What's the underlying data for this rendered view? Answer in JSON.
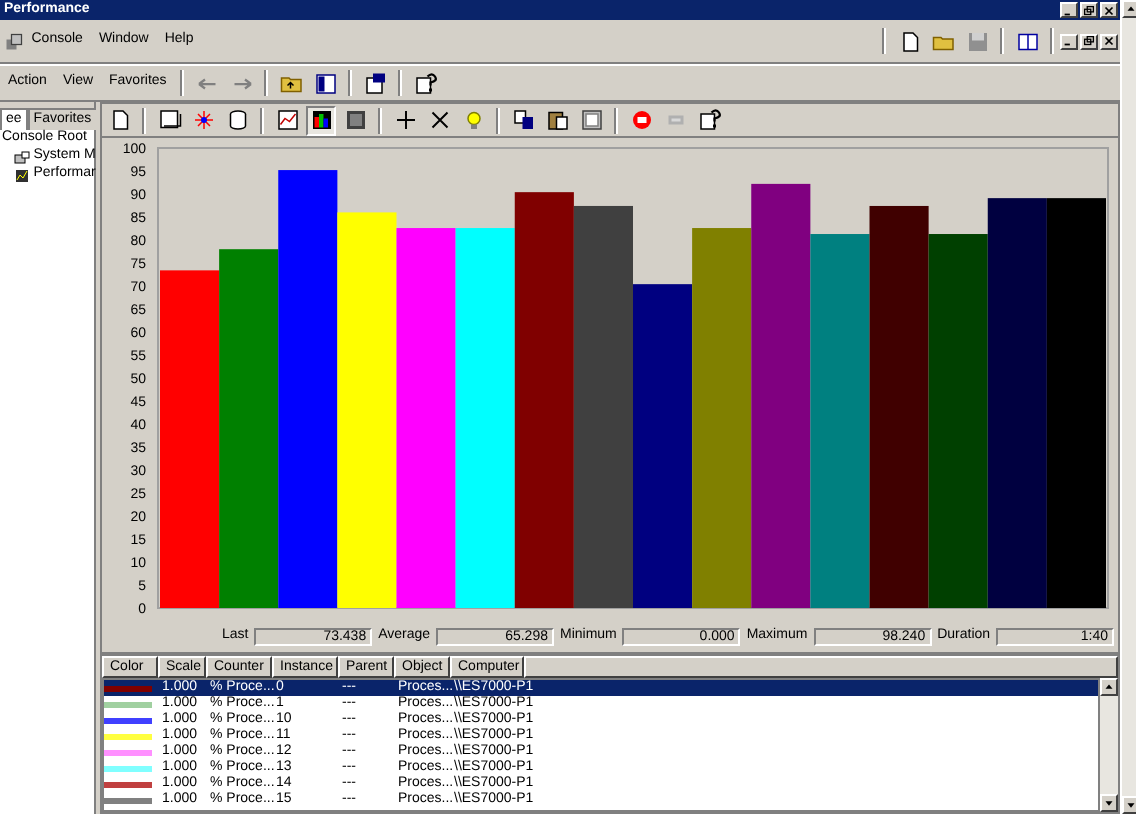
{
  "window": {
    "title": "Performance"
  },
  "menu": [
    "Console",
    "Window",
    "Help"
  ],
  "action_menu": [
    "Action",
    "View",
    "Favorites"
  ],
  "left_tabs": [
    {
      "label": "ee",
      "selected": true
    },
    {
      "label": "Favorites",
      "selected": false
    }
  ],
  "tree": [
    {
      "label": "Console Root",
      "children": [
        {
          "label": "System M"
        },
        {
          "label": "Performar"
        }
      ]
    }
  ],
  "chart_data": {
    "type": "bar",
    "yticks": [
      0,
      5,
      10,
      15,
      20,
      25,
      30,
      35,
      40,
      45,
      50,
      55,
      60,
      65,
      70,
      75,
      80,
      85,
      90,
      95,
      100
    ],
    "ylim": [
      0,
      100
    ],
    "series": [
      {
        "color": "#ff0000",
        "values": [
          73.4
        ]
      },
      {
        "color": "#008000",
        "values": [
          78
        ]
      },
      {
        "color": "#0000ff",
        "values": [
          95.2
        ]
      },
      {
        "color": "#ffff00",
        "values": [
          86
        ]
      },
      {
        "color": "#ff00ff",
        "values": [
          82.6
        ]
      },
      {
        "color": "#00ffff",
        "values": [
          82.6
        ]
      },
      {
        "color": "#800000",
        "values": [
          90.4
        ]
      },
      {
        "color": "#404040",
        "values": [
          87.4
        ]
      },
      {
        "color": "#000080",
        "values": [
          70.4
        ]
      },
      {
        "color": "#808000",
        "values": [
          82.6
        ]
      },
      {
        "color": "#800080",
        "values": [
          92.2
        ]
      },
      {
        "color": "#008080",
        "values": [
          81.3
        ]
      },
      {
        "color": "#400000",
        "values": [
          87.4
        ]
      },
      {
        "color": "#004000",
        "values": [
          81.3
        ]
      },
      {
        "color": "#000040",
        "values": [
          89.1
        ]
      },
      {
        "color": "#000000",
        "values": [
          89.1
        ]
      }
    ]
  },
  "stats": [
    {
      "label": "Last",
      "value": "73.438"
    },
    {
      "label": "Average",
      "value": "65.298"
    },
    {
      "label": "Minimum",
      "value": "0.000"
    },
    {
      "label": "Maximum",
      "value": "98.240"
    },
    {
      "label": "Duration",
      "value": "1:40"
    }
  ],
  "legend": {
    "columns": [
      "Color",
      "Scale",
      "Counter",
      "Instance",
      "Parent",
      "Object",
      "Computer"
    ],
    "rows": [
      {
        "color": "#800000",
        "scale": "1.000",
        "counter": "% Proce...",
        "instance": "0",
        "parent": "---",
        "object": "Proces...",
        "computer": "\\\\ES7000-P1",
        "selected": true
      },
      {
        "color": "#a0d0a0",
        "scale": "1.000",
        "counter": "% Proce...",
        "instance": "1",
        "parent": "---",
        "object": "Proces...",
        "computer": "\\\\ES7000-P1",
        "selected": false
      },
      {
        "color": "#4040ff",
        "scale": "1.000",
        "counter": "% Proce...",
        "instance": "10",
        "parent": "---",
        "object": "Proces...",
        "computer": "\\\\ES7000-P1",
        "selected": false
      },
      {
        "color": "#ffff40",
        "scale": "1.000",
        "counter": "% Proce...",
        "instance": "11",
        "parent": "---",
        "object": "Proces...",
        "computer": "\\\\ES7000-P1",
        "selected": false
      },
      {
        "color": "#ff90ff",
        "scale": "1.000",
        "counter": "% Proce...",
        "instance": "12",
        "parent": "---",
        "object": "Proces...",
        "computer": "\\\\ES7000-P1",
        "selected": false
      },
      {
        "color": "#80ffff",
        "scale": "1.000",
        "counter": "% Proce...",
        "instance": "13",
        "parent": "---",
        "object": "Proces...",
        "computer": "\\\\ES7000-P1",
        "selected": false
      },
      {
        "color": "#c04040",
        "scale": "1.000",
        "counter": "% Proce...",
        "instance": "14",
        "parent": "---",
        "object": "Proces...",
        "computer": "\\\\ES7000-P1",
        "selected": false
      },
      {
        "color": "#808080",
        "scale": "1.000",
        "counter": "% Proce...",
        "instance": "15",
        "parent": "---",
        "object": "Proces...",
        "computer": "\\\\ES7000-P1",
        "selected": false
      }
    ]
  }
}
